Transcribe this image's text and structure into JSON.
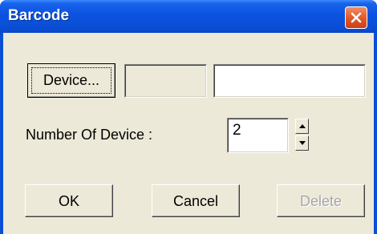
{
  "window": {
    "title": "Barcode"
  },
  "device": {
    "button_label": "Device...",
    "readonly_value": "",
    "text_value": ""
  },
  "number_of_device": {
    "label": "Number Of Device :",
    "value": "2"
  },
  "buttons": {
    "ok_label": "OK",
    "cancel_label": "Cancel",
    "delete_label": "Delete"
  },
  "icons": {
    "close": "close-icon",
    "spin_up": "chevron-up-icon",
    "spin_down": "chevron-down-icon"
  }
}
